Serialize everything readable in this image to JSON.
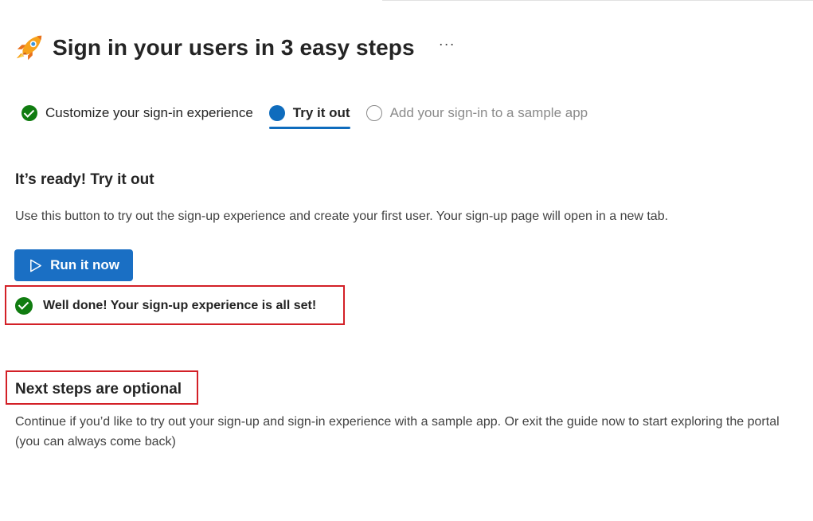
{
  "header": {
    "title": "Sign in your users in 3 easy steps",
    "more_label": "···",
    "icon": "rocket-icon"
  },
  "steps": [
    {
      "label": "Customize your sign-in experience",
      "state": "completed",
      "icon": "check-circle-icon"
    },
    {
      "label": "Try it out",
      "state": "active",
      "icon": "filled-circle-icon"
    },
    {
      "label": "Add your sign-in to a sample app",
      "state": "pending",
      "icon": "empty-circle-icon"
    }
  ],
  "ready": {
    "title": "It’s ready! Try it out",
    "description": "Use this button to try out the sign-up experience and create your first user. Your sign-up page will open in a new tab.",
    "run_button_label": "Run it now",
    "success_message": "Well done! Your sign-up experience is all set!"
  },
  "next_steps": {
    "title": "Next steps are optional",
    "description": "Continue if you’d like to try out your sign-up and sign-in experience with a sample app. Or exit the guide now to start exploring the portal (you can always come back)"
  },
  "colors": {
    "accent": "#0f6cbd",
    "button": "#1a6fc4",
    "success": "#107c10",
    "highlight": "#d32027"
  }
}
